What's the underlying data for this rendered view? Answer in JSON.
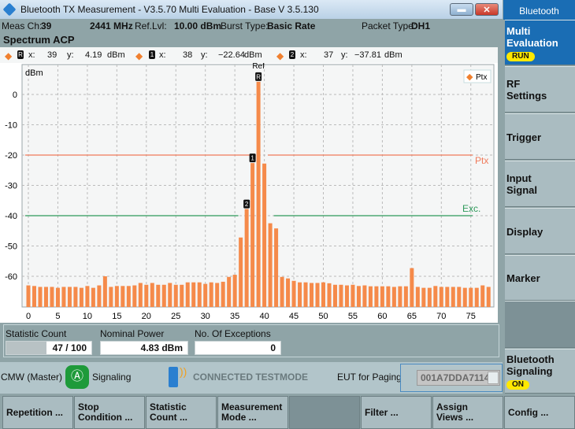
{
  "window": {
    "title": "Bluetooth TX Measurement  - V3.5.70 Multi Evaluation - Base V 3.5.130",
    "minimize_icon": "minimize-icon",
    "close_icon": "close-icon"
  },
  "info": {
    "meas_ch_label": "Meas Ch:",
    "meas_ch": "39",
    "freq": "2441 MHz",
    "ref_lvl_label": "Ref.Lvl:",
    "ref_lvl": "10.00 dBm",
    "burst_type_label": "Burst Type:",
    "burst_type": "Basic Rate",
    "packet_type_label": "Packet Type:",
    "packet_type": "DH1"
  },
  "view_title": "Spectrum ACP",
  "markers": [
    {
      "id": "R",
      "x_label": "x:",
      "x": "39",
      "y_label": "y:",
      "y": "4.19",
      "unit": "dBm"
    },
    {
      "id": "1",
      "x_label": "x:",
      "x": "38",
      "y_label": "y:",
      "y": "−22.64",
      "unit": "dBm"
    },
    {
      "id": "2",
      "x_label": "x:",
      "x": "37",
      "y_label": "y:",
      "y": "−37.81",
      "unit": "dBm"
    }
  ],
  "chart_data": {
    "type": "bar",
    "ylabel": "dBm",
    "ylim": [
      -70,
      10
    ],
    "xlim": [
      0,
      78
    ],
    "grid": true,
    "legend": "top-right",
    "legend_entries": [
      "Ptx"
    ],
    "x_ticks": [
      "0",
      "5",
      "10",
      "15",
      "20",
      "25",
      "30",
      "35",
      "40",
      "45",
      "50",
      "55",
      "60",
      "65",
      "70",
      "75"
    ],
    "y_ticks": [
      "0",
      "-10",
      "-20",
      "-30",
      "-40",
      "-50",
      "-60"
    ],
    "bar_color": "#f58a4a",
    "values": [
      -63,
      -63.2,
      -63.5,
      -63.5,
      -63.5,
      -63.8,
      -63.5,
      -63.5,
      -63.5,
      -63.8,
      -63.2,
      -63.8,
      -63,
      -60,
      -63.5,
      -63.2,
      -63.2,
      -63.2,
      -63,
      -62.2,
      -62.8,
      -62.2,
      -62.8,
      -62.8,
      -62.2,
      -62.8,
      -62.8,
      -62,
      -62,
      -62,
      -62.5,
      -62,
      -62.2,
      -61.8,
      -60.2,
      -59.5,
      -47.2,
      -37.81,
      -22.64,
      4.19,
      -22.8,
      -42.5,
      -44.2,
      -60.2,
      -60.7,
      -61.5,
      -62,
      -62,
      -62.2,
      -62.2,
      -62,
      -62.3,
      -62.8,
      -62.8,
      -63,
      -62.8,
      -63.2,
      -63,
      -63.3,
      -63.3,
      -63.3,
      -63.3,
      -63.5,
      -63.3,
      -63.3,
      -57.3,
      -63.5,
      -63.8,
      -63.8,
      -63.2,
      -63.5,
      -63.5,
      -63.5,
      -63.5,
      -63.8,
      -63.8,
      -63.8,
      -63,
      -63.5
    ],
    "limit_lines": [
      {
        "label": "Ptx",
        "value": -20,
        "color": "#f07a5a"
      },
      {
        "label": "Exc.",
        "value": -40,
        "color": "#2e9a5a"
      }
    ],
    "ref_label": "Ref",
    "marker_flags": [
      {
        "id": "R",
        "x": 39
      },
      {
        "id": "1",
        "x": 38
      },
      {
        "id": "2",
        "x": 37
      }
    ]
  },
  "stats": {
    "statistic_count_label": "Statistic Count",
    "statistic_count": "47 / 100",
    "statistic_progress": 0.47,
    "nominal_power_label": "Nominal Power",
    "nominal_power": "4.83  dBm",
    "exceptions_label": "No. Of Exceptions",
    "exceptions": "0"
  },
  "status": {
    "cmw": "CMW (Master)",
    "signaling": "Signaling",
    "connection": "CONNECTED TESTMODE",
    "eut_label": "EUT for Paging",
    "eut_value": "001A7DDA7114"
  },
  "sidebar": {
    "header": "Bluetooth",
    "items": [
      {
        "label": "Multi\nEvaluation",
        "badge": "RUN"
      },
      {
        "label": "RF\nSettings"
      },
      {
        "label": "Trigger"
      },
      {
        "label": "Input\nSignal"
      },
      {
        "label": "Display"
      },
      {
        "label": "Marker"
      },
      {
        "label": ""
      },
      {
        "label": "Bluetooth\nSignaling",
        "badge": "ON"
      }
    ]
  },
  "buttons": [
    "Repetition ...",
    "Stop\nCondition ...",
    "Statistic\nCount ...",
    "Measurement\nMode ...",
    "",
    "Filter ...",
    "Assign\nViews ...",
    "Config ..."
  ]
}
